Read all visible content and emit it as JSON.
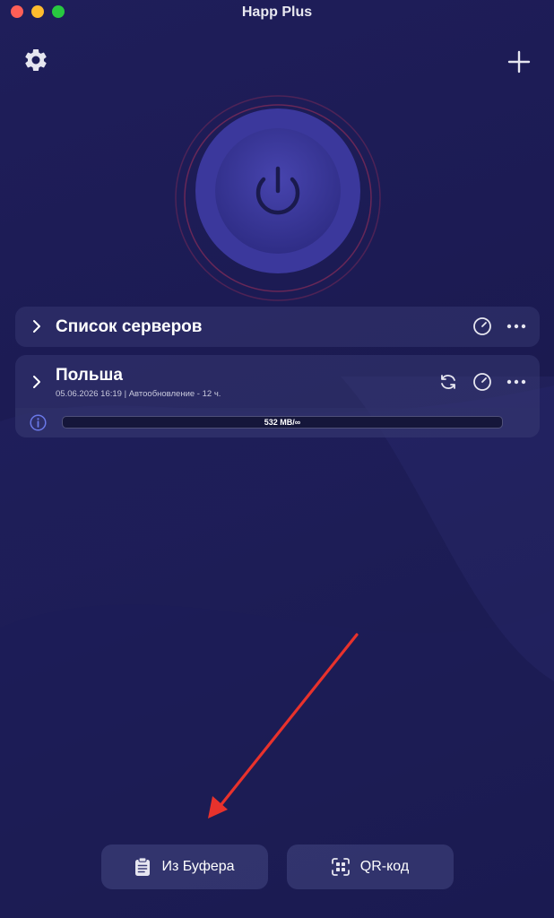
{
  "window": {
    "title": "Happ Plus"
  },
  "header": {
    "settings_icon": "gear-icon",
    "add_icon": "plus-icon"
  },
  "connection": {
    "power_icon": "power-icon",
    "ring_color": "#a8325a",
    "button_color": "#3d3a9c"
  },
  "servers_card": {
    "title": "Список серверов",
    "icons": [
      "speedometer-icon",
      "more-dots-icon"
    ]
  },
  "subscription": {
    "title": "Польша",
    "date": "05.06.2026 16:19",
    "separator": "|",
    "autoupdate": "Автообновление - 12 ч.",
    "traffic": "532 MB/∞",
    "icons": [
      "refresh-icon",
      "speedometer-icon",
      "more-dots-icon",
      "info-icon"
    ]
  },
  "bottom": {
    "clipboard_label": "Из Буфера",
    "qr_label": "QR-код"
  },
  "annotation": {
    "arrow_color": "#e8322c"
  }
}
